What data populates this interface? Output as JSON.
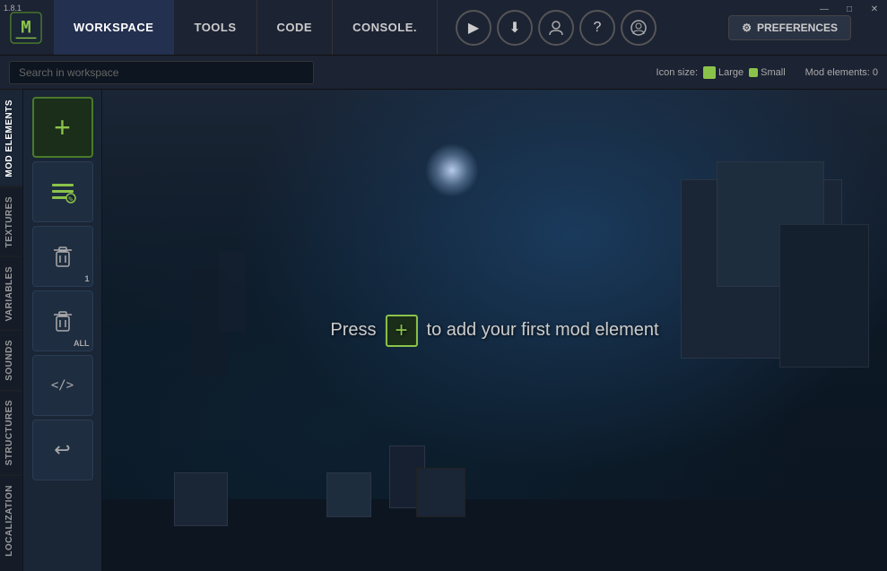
{
  "version": "1.8.1",
  "titlebar": {
    "tabs": [
      {
        "id": "workspace",
        "label": "WORKSPACE",
        "active": true
      },
      {
        "id": "tools",
        "label": "TOOLS",
        "active": false
      },
      {
        "id": "code",
        "label": "CODE",
        "active": false
      },
      {
        "id": "console",
        "label": "CONSOLE.",
        "active": false
      }
    ],
    "toolbar_buttons": [
      {
        "id": "play",
        "icon": "▶",
        "title": "Run"
      },
      {
        "id": "export",
        "icon": "⬇",
        "title": "Export"
      },
      {
        "id": "profile",
        "icon": "☺",
        "title": "Profile"
      },
      {
        "id": "help",
        "icon": "?",
        "title": "Help"
      },
      {
        "id": "account",
        "icon": "☻",
        "title": "Account"
      }
    ],
    "preferences_label": "PREFERENCES",
    "window_controls": [
      "—",
      "□",
      "✕"
    ]
  },
  "search": {
    "placeholder": "Search in workspace"
  },
  "icon_size": {
    "label": "Icon size:",
    "large_label": "Large",
    "small_label": "Small"
  },
  "mod_elements_count": "Mod elements: 0",
  "sidebar_tabs": [
    {
      "id": "mod-elements",
      "label": "Mod elements",
      "active": true
    },
    {
      "id": "textures",
      "label": "Textures"
    },
    {
      "id": "variables",
      "label": "Variables"
    },
    {
      "id": "sounds",
      "label": "Sounds"
    },
    {
      "id": "structures",
      "label": "Structures"
    },
    {
      "id": "localization",
      "label": "Localization"
    }
  ],
  "mod_panel_buttons": [
    {
      "id": "add",
      "icon": "+",
      "badge": "",
      "title": "Add mod element"
    },
    {
      "id": "list",
      "icon": "≡",
      "badge": "",
      "title": "List"
    },
    {
      "id": "delete1",
      "icon": "🗑",
      "badge": "1",
      "title": "Delete 1"
    },
    {
      "id": "delete-all",
      "icon": "🗑",
      "badge": "ALL",
      "title": "Delete All"
    },
    {
      "id": "code-btn",
      "icon": "</>",
      "badge": "",
      "title": "Code"
    },
    {
      "id": "back",
      "icon": "↩",
      "badge": "",
      "title": "Back"
    }
  ],
  "prompt": {
    "pre": "Press",
    "post": "to add your first mod element"
  }
}
